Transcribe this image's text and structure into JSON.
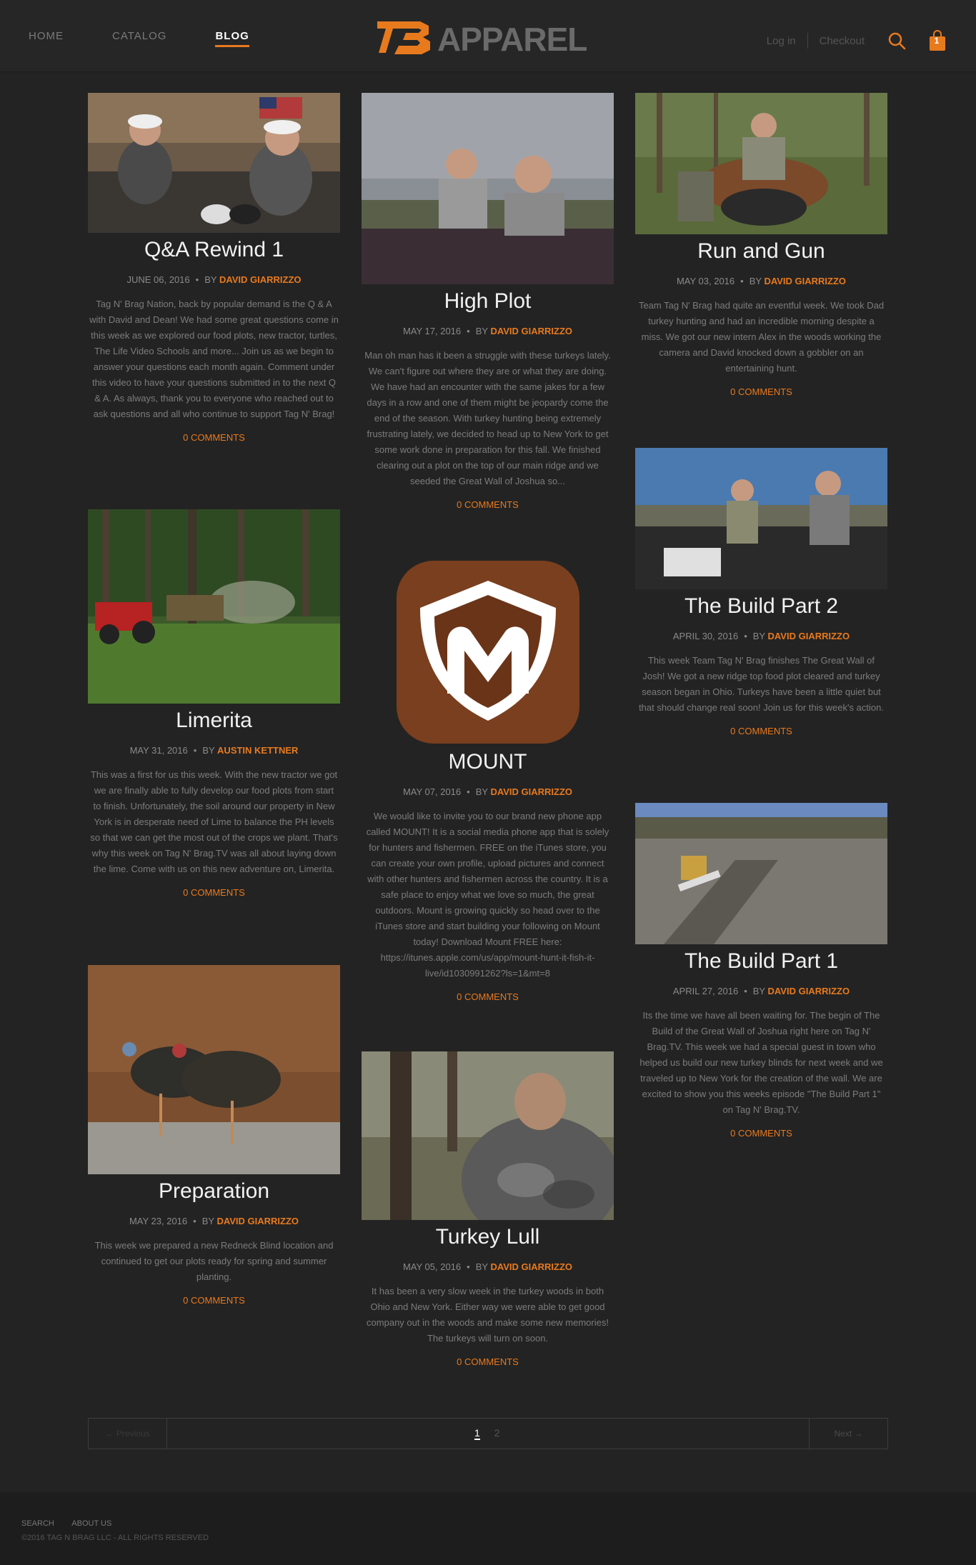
{
  "header": {
    "nav": [
      "HOME",
      "CATALOG",
      "BLOG"
    ],
    "logo_text": "APPAREL",
    "login": "Log in",
    "checkout": "Checkout",
    "cart_count": "1",
    "accent": "#e87a1e"
  },
  "posts": [
    {
      "title": "Q&A Rewind 1",
      "date": "JUNE 06, 2016",
      "by": "BY",
      "author": "DAVID GIARRIZZO",
      "excerpt": "Tag N' Brag Nation, back by popular demand is the Q & A with David and Dean! We had some great questions come in this week as we explored our food plots, new tractor, turtles, The Life Video Schools and more... Join us as we begin to answer your questions each month again. Comment under this video to have your questions submitted in to the next Q & A.  As always, thank you to everyone who reached out to ask questions and all who continue to support Tag N' Brag!",
      "comments": "0 COMMENTS"
    },
    {
      "title": "High Plot",
      "date": "MAY 17, 2016",
      "by": "BY",
      "author": "DAVID GIARRIZZO",
      "excerpt": "Man oh man has it been a struggle with these turkeys lately.  We can't figure out where they are or what they are doing.  We have had an encounter with the same jakes for a few days in a row and one of them might be jeopardy come the end of the season.  With turkey hunting being extremely frustrating lately, we decided to head up to New York to get some work done in preparation for this fall.  We finished clearing out a plot on the top of our main ridge and we seeded the Great Wall of Joshua so...",
      "comments": "0 COMMENTS"
    },
    {
      "title": "Run and Gun",
      "date": "MAY 03, 2016",
      "by": "BY",
      "author": "DAVID GIARRIZZO",
      "excerpt": "Team Tag N' Brag had quite an eventful week.  We took Dad turkey hunting and had an incredible morning despite a miss. We got our new intern Alex in the woods working the camera and David knocked down a gobbler on an entertaining hunt.",
      "comments": "0 COMMENTS"
    },
    {
      "title": "Limerita",
      "date": "MAY 31, 2016",
      "by": "BY",
      "author": "AUSTIN KETTNER",
      "excerpt": "This was a first for us this week. With the new tractor we got we are finally able to fully develop our food plots from start to finish. Unfortunately, the soil around our property in New York is in desperate need of Lime to balance the PH levels so that we can get the most out of the crops we plant. That's why this week on Tag N' Brag.TV was all about laying down the lime. Come with us on this new adventure on, Limerita.",
      "comments": "0 COMMENTS"
    },
    {
      "title": "MOUNT",
      "date": "MAY 07, 2016",
      "by": "BY",
      "author": "DAVID GIARRIZZO",
      "excerpt": "We would like to invite you to our brand new phone app called MOUNT!  It is a social media phone app that is solely for hunters and fishermen.  FREE on the iTunes store, you can create your own profile, upload pictures and connect with other hunters and fishermen across the country.  It is a safe place to enjoy what we love so much, the great outdoors.  Mount is growing quickly so head over to the iTunes store and start building your following on Mount today!  Download Mount FREE here: https://itunes.apple.com/us/app/mount-hunt-it-fish-it-live/id1030991262?ls=1&mt=8",
      "comments": "0 COMMENTS"
    },
    {
      "title": "The Build Part 2",
      "date": "APRIL 30, 2016",
      "by": "BY",
      "author": "DAVID GIARRIZZO",
      "excerpt": "This week Team Tag N' Brag finishes The Great Wall of Josh! We got a new ridge top food plot cleared and turkey season began in Ohio.  Turkeys have been a little quiet but that should change real soon! Join us for this week's action.",
      "comments": "0 COMMENTS"
    },
    {
      "title": "Preparation",
      "date": "MAY 23, 2016",
      "by": "BY",
      "author": "DAVID GIARRIZZO",
      "excerpt": "This week we prepared a new Redneck Blind location and continued to get our plots ready for spring and summer planting.",
      "comments": "0 COMMENTS"
    },
    {
      "title": "Turkey Lull",
      "date": "MAY 05, 2016",
      "by": "BY",
      "author": "DAVID GIARRIZZO",
      "excerpt": "It has been a very slow week in the turkey woods in both Ohio and New York.  Either way we were able to get good company out in the woods and make some new memories!  The turkeys will turn on soon.",
      "comments": "0 COMMENTS"
    },
    {
      "title": "The Build Part 1",
      "date": "APRIL 27, 2016",
      "by": "BY",
      "author": "DAVID GIARRIZZO",
      "excerpt": "Its the time we have all been waiting for. The begin of The Build of the Great Wall of Joshua right here on Tag N' Brag.TV. This week we had a special guest in town who helped us build our new turkey blinds for next week and we traveled up to New York for the creation of the wall. We are excited to show you this weeks episode \"The Build Part 1\" on Tag N' Brag.TV.",
      "comments": "0 COMMENTS"
    }
  ],
  "pagination": {
    "prev": "← Previous",
    "next": "Next →",
    "current": "1",
    "page2": "2"
  },
  "footer": {
    "links": [
      "SEARCH",
      "ABOUT US"
    ],
    "copyright": "©2016 TAG N BRAG LLC - ALL RIGHTS RESERVED"
  }
}
